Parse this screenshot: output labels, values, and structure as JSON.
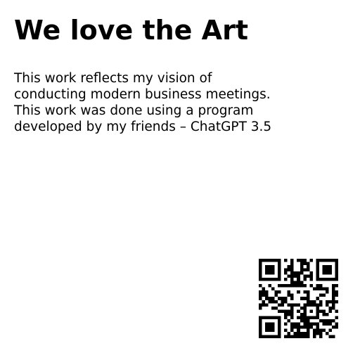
{
  "title": "We love the Art",
  "description": {
    "lines": [
      "This work reflects my vision of",
      "conducting modern business meetings.",
      "This work was done using a program",
      "developed by my friends – ChatGPT 3.5"
    ]
  },
  "qr_code": {
    "icon": "qr-code-icon",
    "color": "#000000",
    "background": "#ffffff"
  }
}
